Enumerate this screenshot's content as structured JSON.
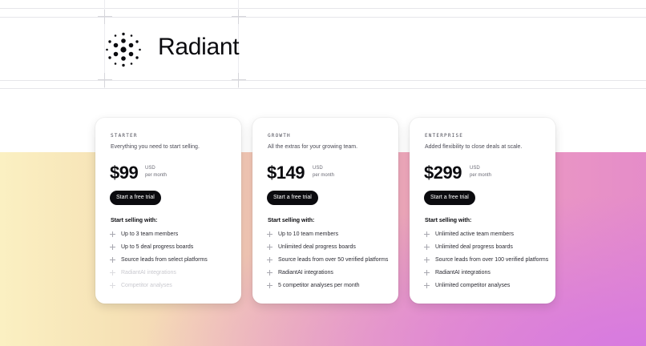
{
  "brand": {
    "name": "Radiant"
  },
  "plans": [
    {
      "tier": "STARTER",
      "description": "Everything you need to start selling.",
      "price": "$99",
      "currency": "USD",
      "period": "per month",
      "cta": "Start a free trial",
      "features_heading": "Start selling with:",
      "features": [
        {
          "text": "Up to 3 team members",
          "included": true
        },
        {
          "text": "Up to 5 deal progress boards",
          "included": true
        },
        {
          "text": "Source leads from select platforms",
          "included": true
        },
        {
          "text": "RadiantAI integrations",
          "included": false
        },
        {
          "text": "Competitor analyses",
          "included": false
        }
      ]
    },
    {
      "tier": "GROWTH",
      "description": "All the extras for your growing team.",
      "price": "$149",
      "currency": "USD",
      "period": "per month",
      "cta": "Start a free trial",
      "features_heading": "Start selling with:",
      "features": [
        {
          "text": "Up to 10 team members",
          "included": true
        },
        {
          "text": "Unlimited deal progress boards",
          "included": true
        },
        {
          "text": "Source leads from over 50 verified platforms",
          "included": true
        },
        {
          "text": "RadiantAI integrations",
          "included": true
        },
        {
          "text": "5 competitor analyses per month",
          "included": true
        }
      ]
    },
    {
      "tier": "ENTERPRISE",
      "description": "Added flexibility to close deals at scale.",
      "price": "$299",
      "currency": "USD",
      "period": "per month",
      "cta": "Start a free trial",
      "features_heading": "Start selling with:",
      "features": [
        {
          "text": "Unlimited active team members",
          "included": true
        },
        {
          "text": "Unlimited deal progress boards",
          "included": true
        },
        {
          "text": "Source leads from over 100 verified platforms",
          "included": true
        },
        {
          "text": "RadiantAI integrations",
          "included": true
        },
        {
          "text": "Unlimited competitor analyses",
          "included": true
        }
      ]
    }
  ],
  "icons": {
    "logo": "radiant-dots-logo-icon",
    "feature_bullet": "plus-icon"
  },
  "colors": {
    "button": "#0b0b0f",
    "gradient_start": "#fbf0c2",
    "gradient_mid": "#f2bfb6",
    "gradient_end": "#d77ae0"
  }
}
